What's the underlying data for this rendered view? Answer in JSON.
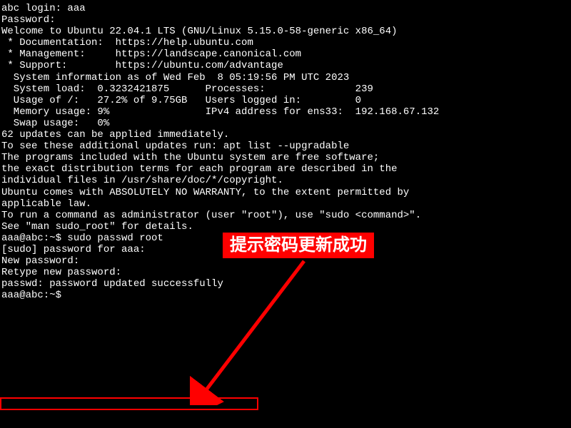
{
  "terminal": {
    "lines": [
      "abc login: aaa",
      "Password:",
      "Welcome to Ubuntu 22.04.1 LTS (GNU/Linux 5.15.0-58-generic x86_64)",
      "",
      " * Documentation:  https://help.ubuntu.com",
      " * Management:     https://landscape.canonical.com",
      " * Support:        https://ubuntu.com/advantage",
      "",
      "  System information as of Wed Feb  8 05:19:56 PM UTC 2023",
      "",
      "  System load:  0.3232421875      Processes:               239",
      "  Usage of /:   27.2% of 9.75GB   Users logged in:         0",
      "  Memory usage: 9%                IPv4 address for ens33:  192.168.67.132",
      "  Swap usage:   0%",
      "",
      "",
      "62 updates can be applied immediately.",
      "To see these additional updates run: apt list --upgradable",
      "",
      "",
      "",
      "The programs included with the Ubuntu system are free software;",
      "the exact distribution terms for each program are described in the",
      "individual files in /usr/share/doc/*/copyright.",
      "",
      "Ubuntu comes with ABSOLUTELY NO WARRANTY, to the extent permitted by",
      "applicable law.",
      "",
      "To run a command as administrator (user \"root\"), use \"sudo <command>\".",
      "See \"man sudo_root\" for details.",
      "",
      "aaa@abc:~$ sudo passwd root",
      "[sudo] password for aaa:",
      "New password:",
      "Retype new password:",
      "passwd: password updated successfully",
      "aaa@abc:~$ "
    ]
  },
  "annotation": {
    "text": "提示密码更新成功"
  }
}
